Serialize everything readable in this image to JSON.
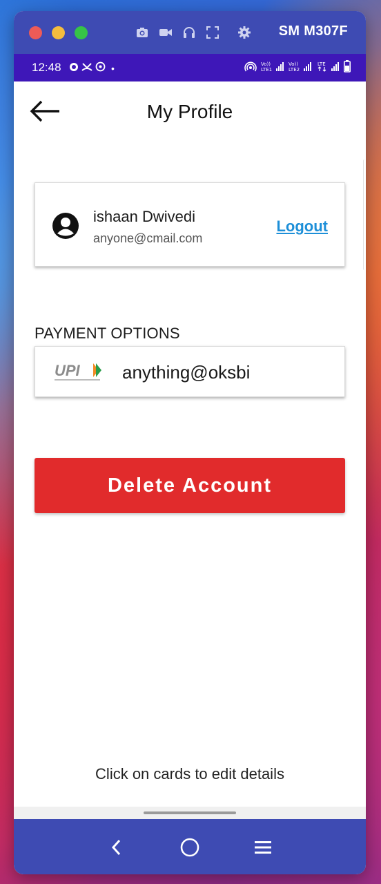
{
  "window": {
    "device_name": "SM M307F"
  },
  "statusbar": {
    "time": "12:48",
    "dot": "•"
  },
  "appbar": {
    "title": "My Profile"
  },
  "profile": {
    "name": "ishaan Dwivedi",
    "email": "anyone@cmail.com",
    "logout_label": "Logout"
  },
  "payment": {
    "section_label": "PAYMENT OPTIONS",
    "upi_id": "anything@oksbi",
    "logo_text": "UPI"
  },
  "actions": {
    "delete_label": "Delete Account"
  },
  "footer": {
    "hint": "Click on cards to edit details"
  },
  "colors": {
    "titlebar": "#3e4bb3",
    "statusbar": "#3e17b8",
    "delete_button": "#e12b2c",
    "logout_link": "#1d8fd8"
  },
  "icons": {
    "titlebar": [
      "camera-icon",
      "video-icon",
      "headphones-icon",
      "fullscreen-icon",
      "settings-icon"
    ],
    "navbar": [
      "back-icon",
      "home-icon",
      "menu-icon"
    ]
  }
}
